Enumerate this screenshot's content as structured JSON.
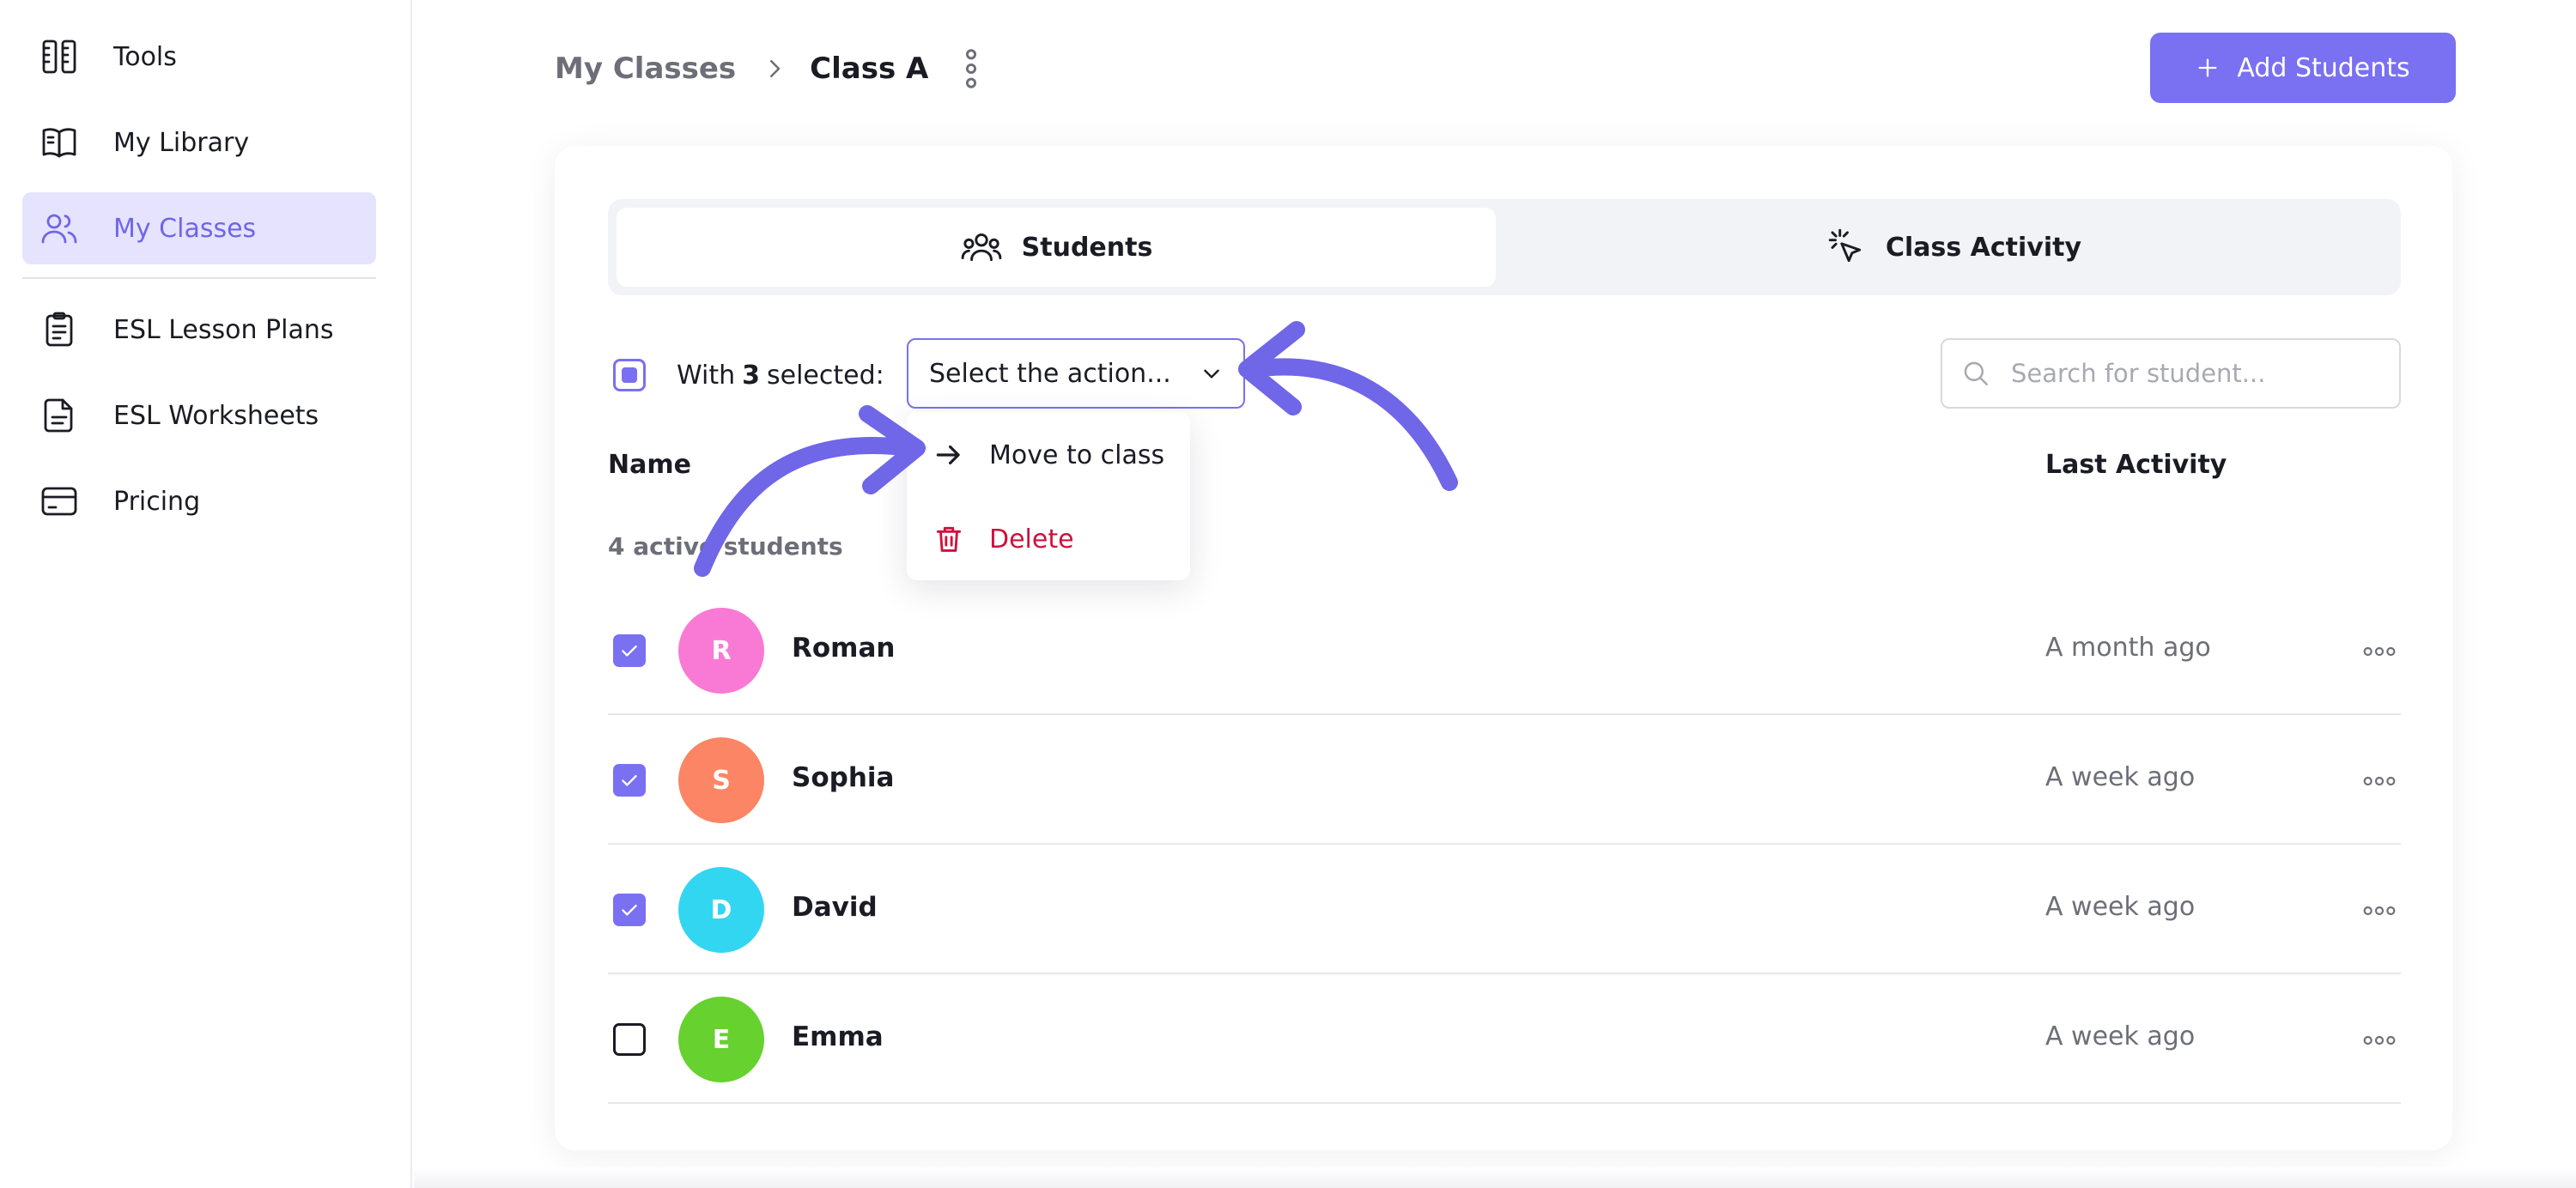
{
  "sidebar": {
    "items": [
      {
        "label": "Tools",
        "icon": "tools-icon"
      },
      {
        "label": "My Library",
        "icon": "book-icon"
      },
      {
        "label": "My Classes",
        "icon": "users-icon",
        "active": true
      },
      {
        "label": "ESL Lesson Plans",
        "icon": "clipboard-icon"
      },
      {
        "label": "ESL Worksheets",
        "icon": "document-icon"
      },
      {
        "label": "Pricing",
        "icon": "credit-card-icon"
      }
    ]
  },
  "header": {
    "breadcrumb_root": "My Classes",
    "breadcrumb_current": "Class A",
    "add_students_label": "Add Students"
  },
  "tabs": [
    {
      "label": "Students",
      "icon": "users-icon",
      "active": true
    },
    {
      "label": "Class Activity",
      "icon": "cursor-click-icon",
      "active": false
    }
  ],
  "selection": {
    "prefix": "With",
    "count": "3",
    "suffix": "selected:",
    "action_select_value": "Select the action...",
    "action_options": [
      "Move to class",
      "Delete"
    ]
  },
  "search": {
    "placeholder": "Search for student..."
  },
  "table": {
    "col_name": "Name",
    "col_activity": "Last Activity",
    "active_count_label": "4 active students",
    "rows": [
      {
        "initial": "R",
        "name": "Roman",
        "last_activity": "A month ago",
        "checked": true,
        "color": "#f97ad4"
      },
      {
        "initial": "S",
        "name": "Sophia",
        "last_activity": "A week ago",
        "checked": true,
        "color": "#fb8564"
      },
      {
        "initial": "D",
        "name": "David",
        "last_activity": "A week ago",
        "checked": true,
        "color": "#33d6f0"
      },
      {
        "initial": "E",
        "name": "Emma",
        "last_activity": "A week ago",
        "checked": false,
        "color": "#66d12f"
      }
    ]
  },
  "colors": {
    "accent": "#7a70f2",
    "accent_light": "#e6e3ff",
    "danger": "#d0103c",
    "muted_text": "#6e6e78"
  }
}
